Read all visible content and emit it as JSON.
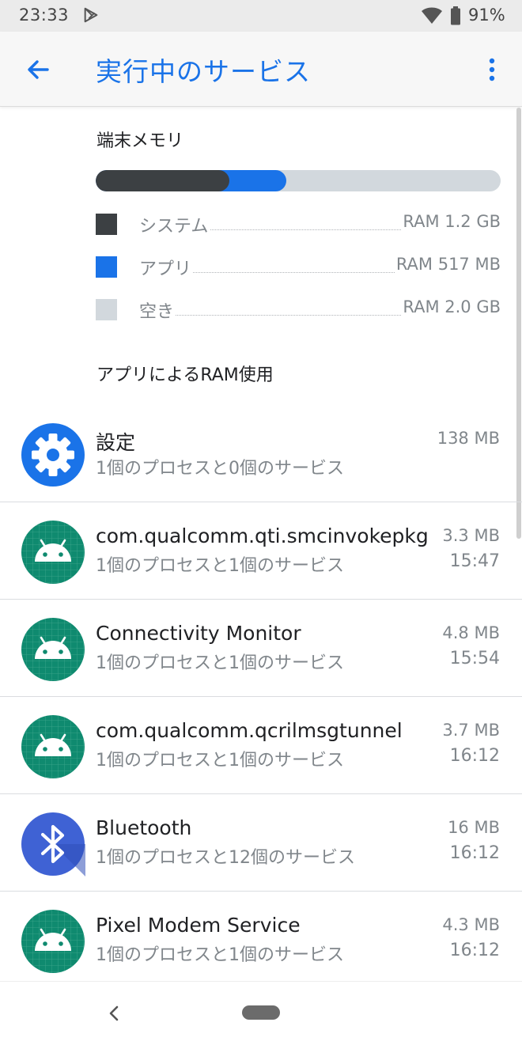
{
  "status_bar": {
    "time": "23:33",
    "battery": "91%",
    "notification_icon": "play-store-icon",
    "wifi_icon": "wifi-icon",
    "battery_icon": "battery-icon"
  },
  "app_bar": {
    "title": "実行中のサービス",
    "back_icon": "arrow-back-icon",
    "more_icon": "more-vert-icon"
  },
  "memory": {
    "heading": "端末メモリ",
    "usage_fraction": {
      "system": 0.33,
      "app": 0.14,
      "free": 0.53
    },
    "legend": [
      {
        "label": "システム",
        "value": "RAM 1.2 GB",
        "color": "#3c4043"
      },
      {
        "label": "アプリ",
        "value": "RAM 517 MB",
        "color": "#1a73e8"
      },
      {
        "label": "空き",
        "value": "RAM 2.0 GB",
        "color": "#d2d8dd"
      }
    ]
  },
  "usage_heading": "アプリによるRAM使用",
  "apps": [
    {
      "name": "設定",
      "subtitle": "1個のプロセスと0個のサービス",
      "size": "138 MB",
      "time": "",
      "icon": "settings-gear-icon"
    },
    {
      "name": "com.qualcomm.qti.smcinvokepkg..",
      "subtitle": "1個のプロセスと1個のサービス",
      "size": "3.3 MB",
      "time": "15:47",
      "icon": "android-icon"
    },
    {
      "name": "Connectivity Monitor",
      "subtitle": "1個のプロセスと1個のサービス",
      "size": "4.8 MB",
      "time": "15:54",
      "icon": "android-icon"
    },
    {
      "name": "com.qualcomm.qcrilmsgtunnel",
      "subtitle": "1個のプロセスと1個のサービス",
      "size": "3.7 MB",
      "time": "16:12",
      "icon": "android-icon"
    },
    {
      "name": "Bluetooth",
      "subtitle": "1個のプロセスと12個のサービス",
      "size": "16 MB",
      "time": "16:12",
      "icon": "bluetooth-icon"
    },
    {
      "name": "Pixel Modem Service",
      "subtitle": "1個のプロセスと1個のサービス",
      "size": "4.3 MB",
      "time": "16:12",
      "icon": "android-icon"
    }
  ],
  "nav_bar": {
    "back_icon": "nav-back-icon",
    "home_icon": "home-pill-icon"
  },
  "colors": {
    "accent": "#1a73e8",
    "system": "#3c4043",
    "free": "#d2d8dd",
    "android_bg": "#0f8a6f",
    "bluetooth_bg": "#3f62d4"
  }
}
